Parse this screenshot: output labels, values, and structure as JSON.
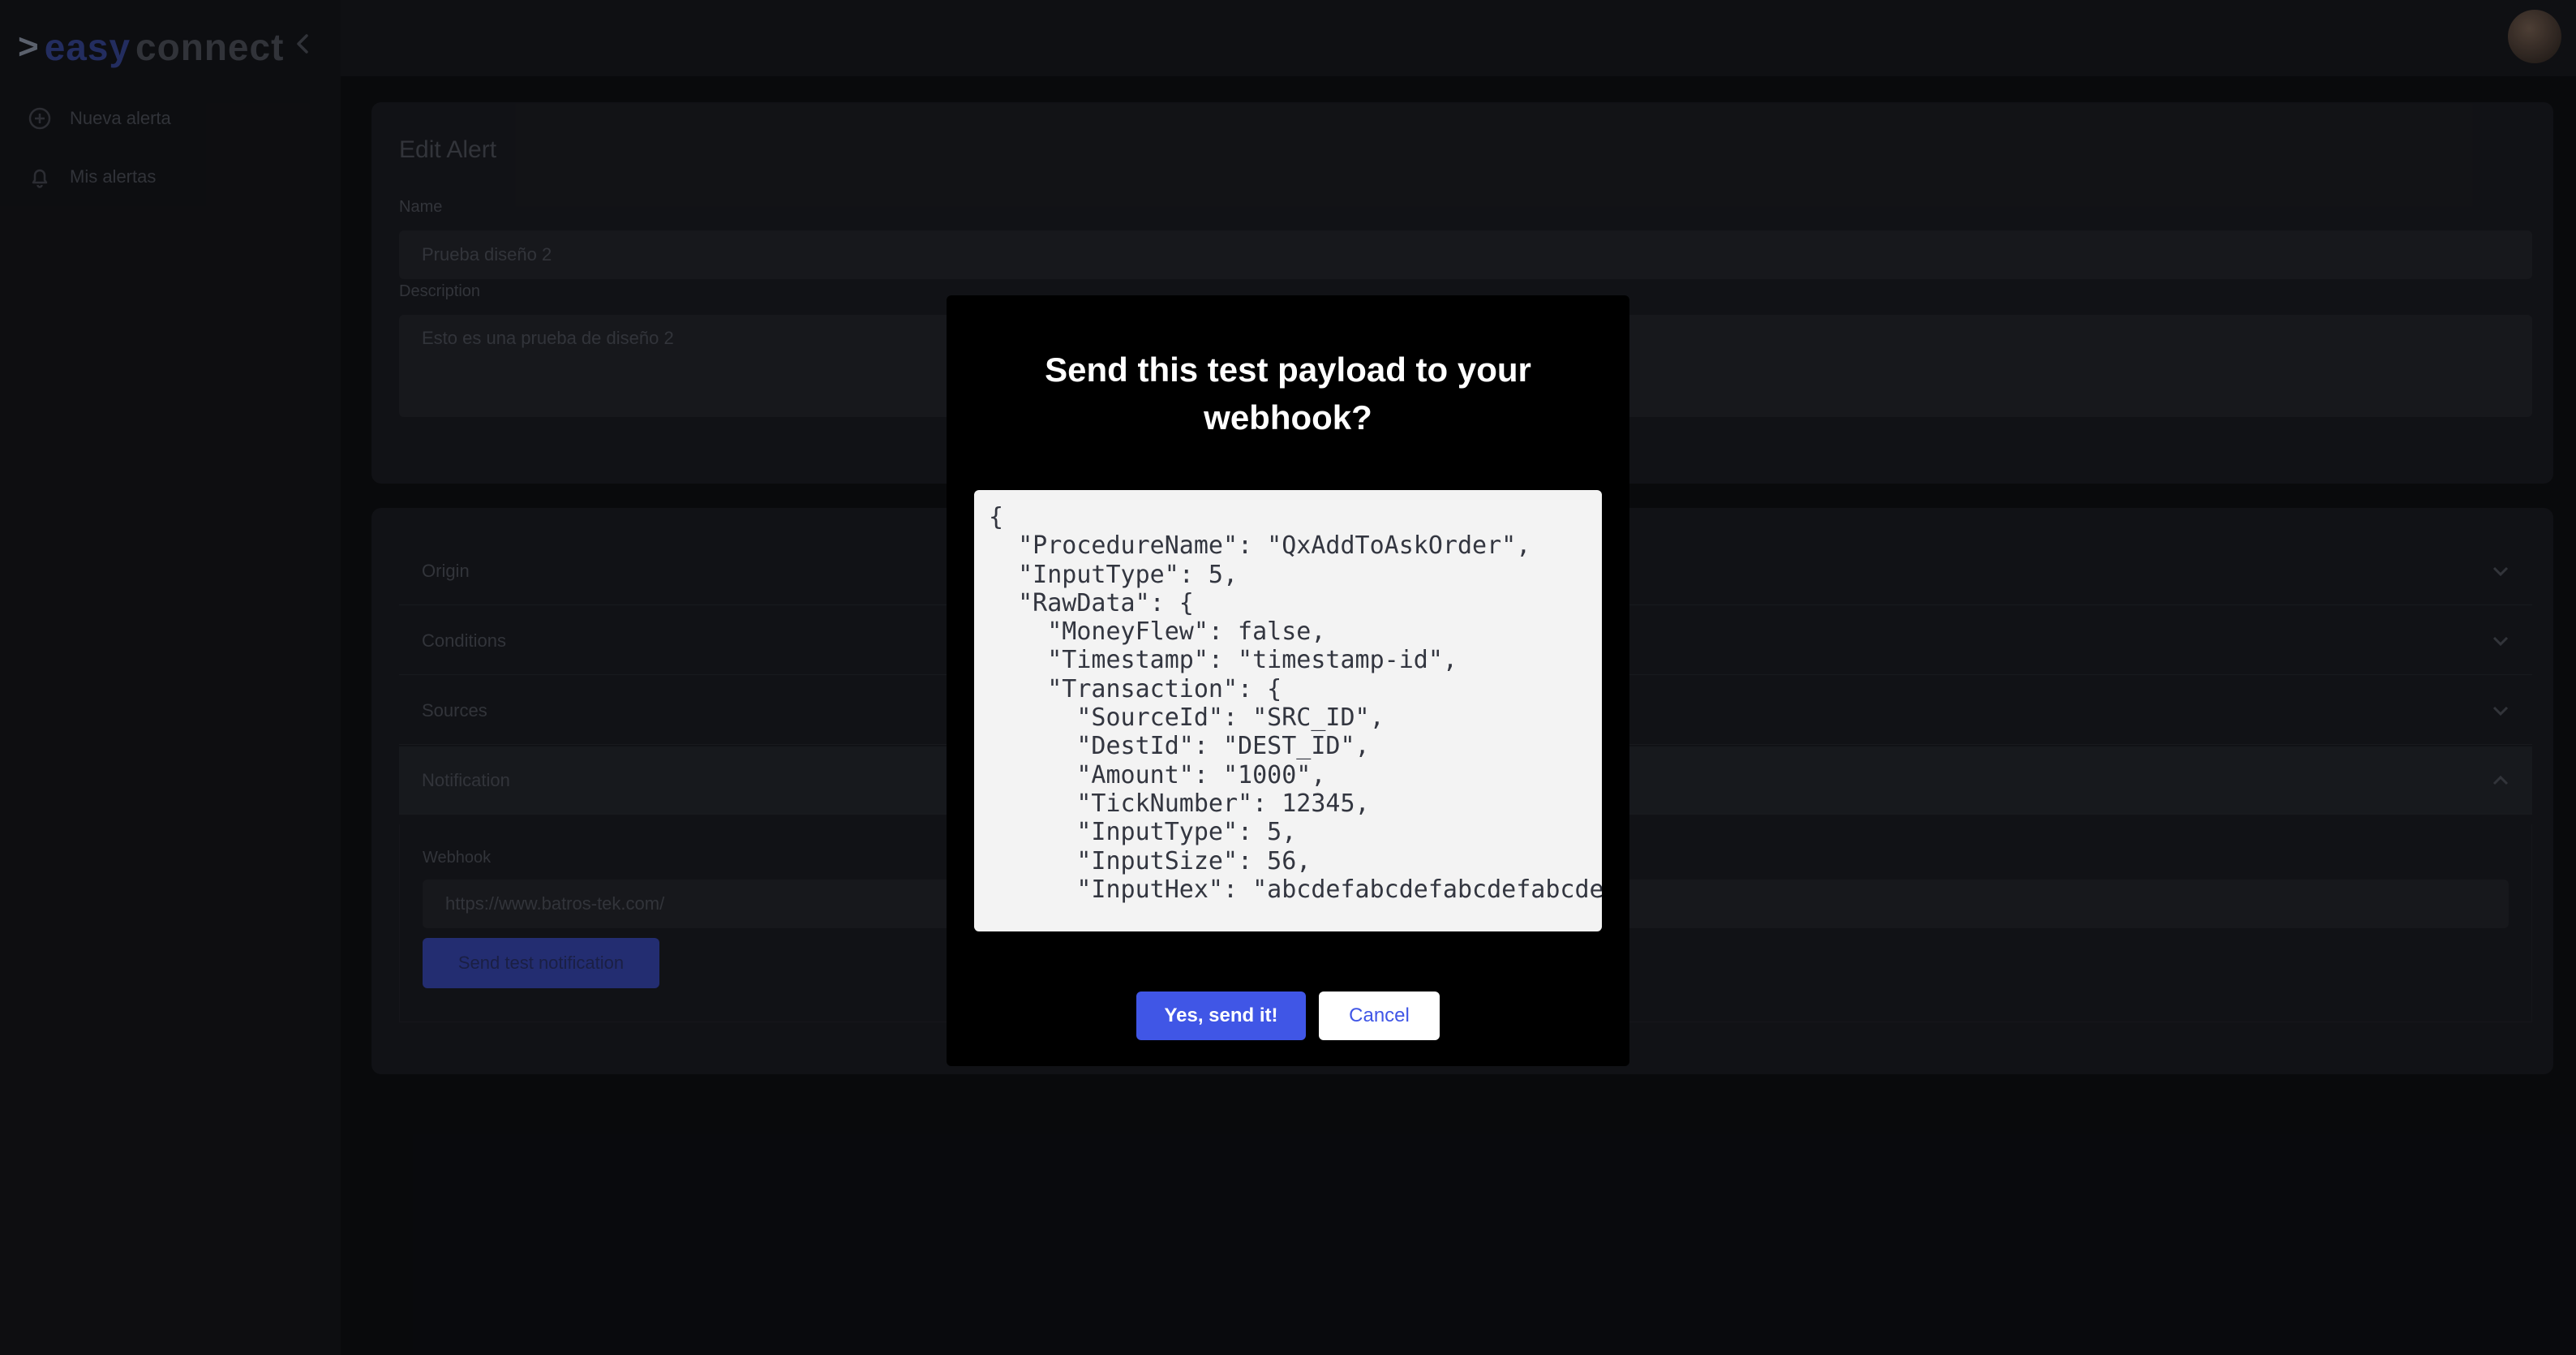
{
  "logo": {
    "prefix": ">",
    "part1": "easy",
    "part2": "connect"
  },
  "sidebar": {
    "items": [
      {
        "label": "Nueva alerta",
        "icon": "plus-circle-icon"
      },
      {
        "label": "Mis alertas",
        "icon": "bell-icon"
      }
    ]
  },
  "edit_form": {
    "title": "Edit Alert",
    "name_label": "Name",
    "name_value": "Prueba diseño 2",
    "description_label": "Description",
    "description_value": "Esto es una prueba de diseño 2"
  },
  "accordion": {
    "sections": [
      {
        "label": "Origin"
      },
      {
        "label": "Conditions"
      },
      {
        "label": "Sources"
      },
      {
        "label": "Notification"
      }
    ],
    "webhook_label": "Webhook",
    "webhook_value": "https://www.batros-tek.com/",
    "send_button": "Send test notification"
  },
  "modal": {
    "title": "Send this test payload to your webhook?",
    "payload": "{\n  \"ProcedureName\": \"QxAddToAskOrder\",\n  \"InputType\": 5,\n  \"RawData\": {\n    \"MoneyFlew\": false,\n    \"Timestamp\": \"timestamp-id\",\n    \"Transaction\": {\n      \"SourceId\": \"SRC_ID\",\n      \"DestId\": \"DEST_ID\",\n      \"Amount\": \"1000\",\n      \"TickNumber\": 12345,\n      \"InputType\": 5,\n      \"InputSize\": 56,\n      \"InputHex\": \"abcdefabcdefabcdefabcdefabcdef\"",
    "confirm_label": "Yes, send it!",
    "cancel_label": "Cancel"
  },
  "colors": {
    "accent": "#4056e6",
    "modal_bg": "#000000",
    "payload_bg": "#f3f3f3"
  }
}
